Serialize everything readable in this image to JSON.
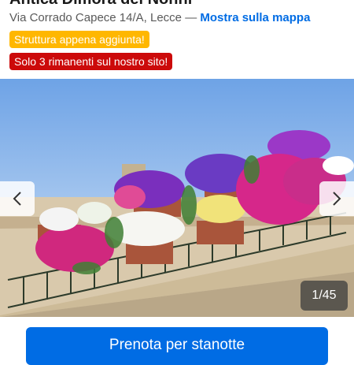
{
  "property": {
    "name": "Antica Dimora dei Nonni",
    "address": "Via Corrado Capece 14/A, Lecce —",
    "map_link": "Mostra sulla mappa"
  },
  "badges": {
    "new": "Struttura appena aggiunta!",
    "rooms_left": "Solo 3 rimanenti sul nostro sito!"
  },
  "gallery": {
    "counter": "1/45",
    "prev_icon": "chevron-left-icon",
    "next_icon": "chevron-right-icon",
    "photo": "balcony-flowers-photo"
  },
  "cta": {
    "book_label": "Prenota per stanotte"
  },
  "colors": {
    "primary": "#006ce4",
    "badge_new": "#ffb700",
    "badge_urgent": "#cc0a0a"
  }
}
